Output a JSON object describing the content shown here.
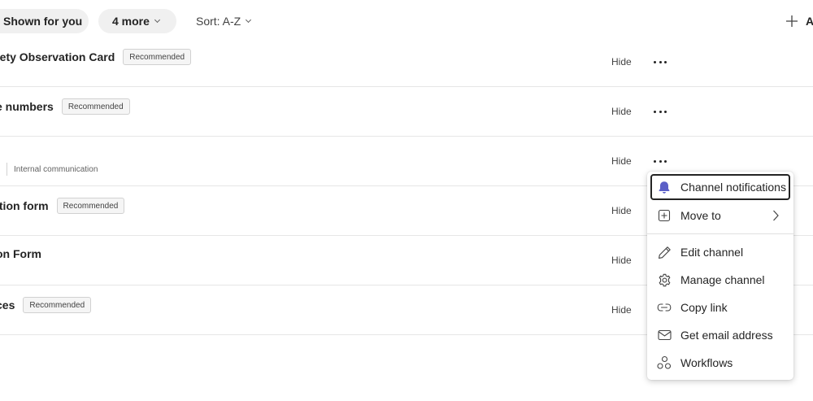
{
  "toolbar": {
    "shown_for_you_label": "Shown for you",
    "more_filters_label": "4 more",
    "sort_label": "Sort: A-Z",
    "add_label": "A"
  },
  "channels": [
    {
      "name": "fety Observation Card",
      "badge": "Recommended",
      "hide_label": "Hide"
    },
    {
      "name": "e numbers",
      "badge": "Recommended",
      "hide_label": "Hide"
    },
    {
      "name": "",
      "subtitle": "Internal communication",
      "hide_label": "Hide"
    },
    {
      "name": "ition form",
      "badge": "Recommended",
      "hide_label": "Hide"
    },
    {
      "name": "on Form",
      "hide_label": "Hide"
    },
    {
      "name": "ces",
      "badge": "Recommended",
      "hide_label": "Hide"
    }
  ],
  "context_menu": {
    "items": [
      {
        "label": "Channel notifications",
        "icon": "bell-icon",
        "focused": true
      },
      {
        "label": "Move to",
        "icon": "move-to-icon",
        "submenu": true
      },
      {
        "label": "Edit channel",
        "icon": "pencil-icon"
      },
      {
        "label": "Manage channel",
        "icon": "gear-icon"
      },
      {
        "label": "Copy link",
        "icon": "link-icon"
      },
      {
        "label": "Get email address",
        "icon": "mail-icon"
      },
      {
        "label": "Workflows",
        "icon": "workflows-icon"
      }
    ]
  },
  "colors": {
    "accent": "#5b5fc7",
    "pill_bg": "#f0f0f0",
    "divider": "#e6e6e6"
  }
}
